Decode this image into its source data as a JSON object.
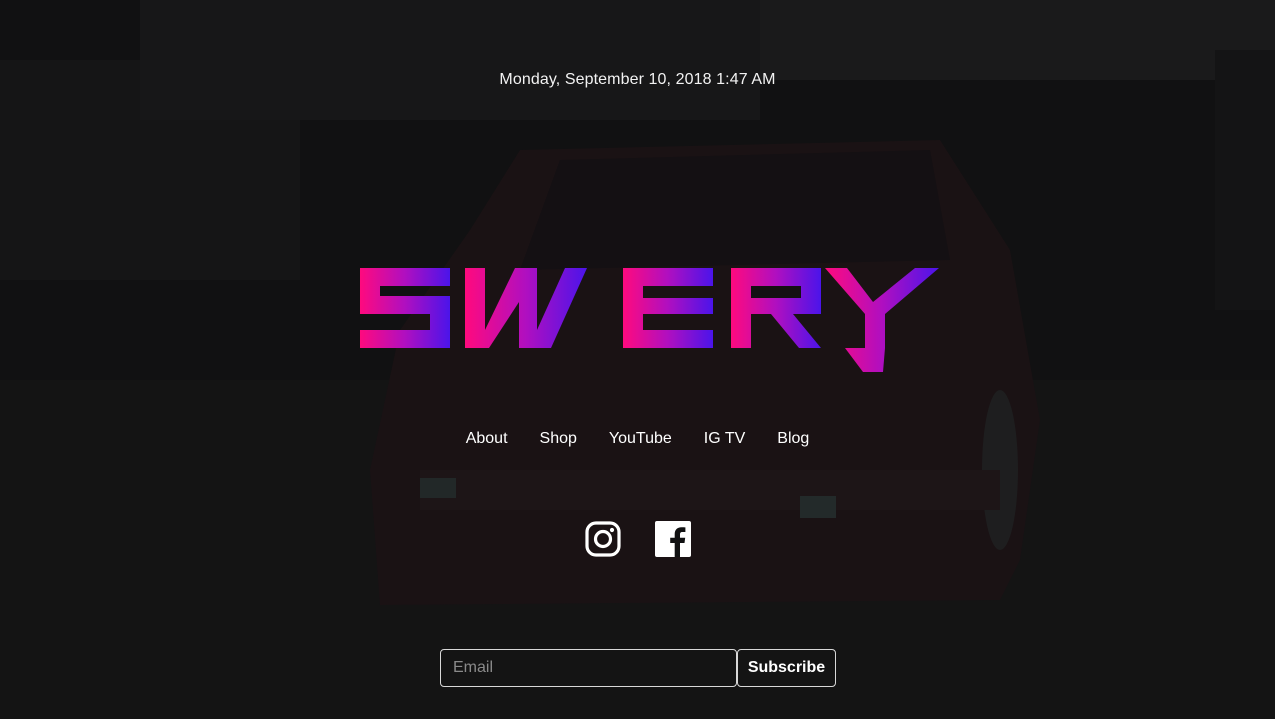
{
  "header": {
    "datetime": "Monday, September 10, 2018 1:47 AM"
  },
  "brand": {
    "logo_text": "SWERY",
    "logo_icon": "swery-logo",
    "gradient_start": "#ff0a7e",
    "gradient_mid": "#b00fc0",
    "gradient_end": "#4b14ea"
  },
  "nav": {
    "items": [
      {
        "label": "About"
      },
      {
        "label": "Shop"
      },
      {
        "label": "YouTube"
      },
      {
        "label": "IG TV"
      },
      {
        "label": "Blog"
      }
    ]
  },
  "social": {
    "instagram_icon": "instagram-icon",
    "facebook_icon": "facebook-icon"
  },
  "subscribe": {
    "email_placeholder": "Email",
    "email_value": "",
    "button_label": "Subscribe"
  },
  "colors": {
    "background": "#0c0c0d",
    "text": "#ffffff"
  }
}
